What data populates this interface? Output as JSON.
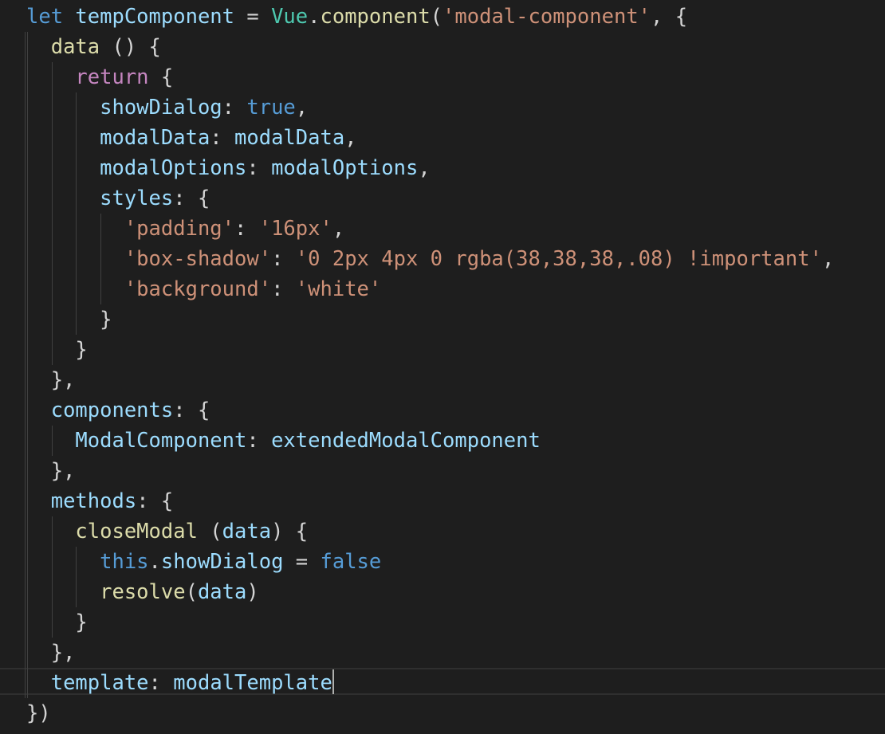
{
  "editor": {
    "language": "javascript",
    "theme": "dark",
    "colors": {
      "background": "#1e1e1e",
      "keyword": "#569cd6",
      "control": "#c586c0",
      "variable": "#9cdcfe",
      "function": "#dcdcaa",
      "class": "#4ec9b0",
      "string": "#ce9178",
      "punctuation": "#d4d4d4"
    },
    "cursor_line": 23,
    "lines": [
      [
        {
          "t": "kw",
          "v": "let"
        },
        {
          "t": "pun",
          "v": " "
        },
        {
          "t": "var",
          "v": "tempComponent"
        },
        {
          "t": "pun",
          "v": " = "
        },
        {
          "t": "cls",
          "v": "Vue"
        },
        {
          "t": "pun",
          "v": "."
        },
        {
          "t": "fn",
          "v": "component"
        },
        {
          "t": "pun",
          "v": "("
        },
        {
          "t": "str",
          "v": "'modal-component'"
        },
        {
          "t": "pun",
          "v": ", {"
        }
      ],
      [
        {
          "t": "pun",
          "v": "  "
        },
        {
          "t": "fn",
          "v": "data"
        },
        {
          "t": "pun",
          "v": " () {"
        }
      ],
      [
        {
          "t": "pun",
          "v": "    "
        },
        {
          "t": "ctl",
          "v": "return"
        },
        {
          "t": "pun",
          "v": " {"
        }
      ],
      [
        {
          "t": "pun",
          "v": "      "
        },
        {
          "t": "var",
          "v": "showDialog"
        },
        {
          "t": "pun",
          "v": ": "
        },
        {
          "t": "kw",
          "v": "true"
        },
        {
          "t": "pun",
          "v": ","
        }
      ],
      [
        {
          "t": "pun",
          "v": "      "
        },
        {
          "t": "var",
          "v": "modalData"
        },
        {
          "t": "pun",
          "v": ": "
        },
        {
          "t": "var",
          "v": "modalData"
        },
        {
          "t": "pun",
          "v": ","
        }
      ],
      [
        {
          "t": "pun",
          "v": "      "
        },
        {
          "t": "var",
          "v": "modalOptions"
        },
        {
          "t": "pun",
          "v": ": "
        },
        {
          "t": "var",
          "v": "modalOptions"
        },
        {
          "t": "pun",
          "v": ","
        }
      ],
      [
        {
          "t": "pun",
          "v": "      "
        },
        {
          "t": "var",
          "v": "styles"
        },
        {
          "t": "pun",
          "v": ": {"
        }
      ],
      [
        {
          "t": "pun",
          "v": "        "
        },
        {
          "t": "str",
          "v": "'padding'"
        },
        {
          "t": "pun",
          "v": ": "
        },
        {
          "t": "str",
          "v": "'16px'"
        },
        {
          "t": "pun",
          "v": ","
        }
      ],
      [
        {
          "t": "pun",
          "v": "        "
        },
        {
          "t": "str",
          "v": "'box-shadow'"
        },
        {
          "t": "pun",
          "v": ": "
        },
        {
          "t": "str",
          "v": "'0 2px 4px 0 rgba(38,38,38,.08) !important'"
        },
        {
          "t": "pun",
          "v": ","
        }
      ],
      [
        {
          "t": "pun",
          "v": "        "
        },
        {
          "t": "str",
          "v": "'background'"
        },
        {
          "t": "pun",
          "v": ": "
        },
        {
          "t": "str",
          "v": "'white'"
        }
      ],
      [
        {
          "t": "pun",
          "v": "      }"
        }
      ],
      [
        {
          "t": "pun",
          "v": "    }"
        }
      ],
      [
        {
          "t": "pun",
          "v": "  },"
        }
      ],
      [
        {
          "t": "pun",
          "v": "  "
        },
        {
          "t": "var",
          "v": "components"
        },
        {
          "t": "pun",
          "v": ": {"
        }
      ],
      [
        {
          "t": "pun",
          "v": "    "
        },
        {
          "t": "var",
          "v": "ModalComponent"
        },
        {
          "t": "pun",
          "v": ": "
        },
        {
          "t": "var",
          "v": "extendedModalComponent"
        }
      ],
      [
        {
          "t": "pun",
          "v": "  },"
        }
      ],
      [
        {
          "t": "pun",
          "v": "  "
        },
        {
          "t": "var",
          "v": "methods"
        },
        {
          "t": "pun",
          "v": ": {"
        }
      ],
      [
        {
          "t": "pun",
          "v": "    "
        },
        {
          "t": "fn",
          "v": "closeModal"
        },
        {
          "t": "pun",
          "v": " ("
        },
        {
          "t": "var",
          "v": "data"
        },
        {
          "t": "pun",
          "v": ") {"
        }
      ],
      [
        {
          "t": "pun",
          "v": "      "
        },
        {
          "t": "kw",
          "v": "this"
        },
        {
          "t": "pun",
          "v": "."
        },
        {
          "t": "var",
          "v": "showDialog"
        },
        {
          "t": "pun",
          "v": " = "
        },
        {
          "t": "kw",
          "v": "false"
        }
      ],
      [
        {
          "t": "pun",
          "v": "      "
        },
        {
          "t": "fn",
          "v": "resolve"
        },
        {
          "t": "pun",
          "v": "("
        },
        {
          "t": "var",
          "v": "data"
        },
        {
          "t": "pun",
          "v": ")"
        }
      ],
      [
        {
          "t": "pun",
          "v": "    }"
        }
      ],
      [
        {
          "t": "pun",
          "v": "  },"
        }
      ],
      [
        {
          "t": "pun",
          "v": "  "
        },
        {
          "t": "var",
          "v": "template"
        },
        {
          "t": "pun",
          "v": ": "
        },
        {
          "t": "var",
          "v": "modalTemplate"
        }
      ],
      [
        {
          "t": "pun",
          "v": "})"
        }
      ]
    ]
  }
}
